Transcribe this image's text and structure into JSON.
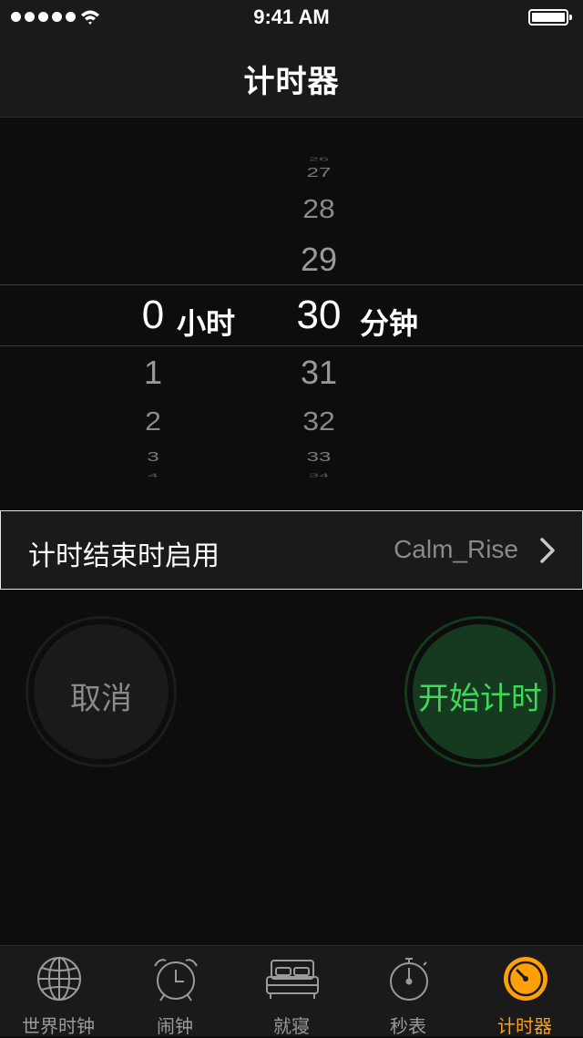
{
  "status_bar": {
    "time": "9:41 AM"
  },
  "nav": {
    "title": "计时器"
  },
  "picker": {
    "hours_above": [],
    "hours_selected": "0",
    "hours_unit": "小时",
    "hours_below": [
      "1",
      "2",
      "3",
      "4"
    ],
    "minutes_above": [
      "26",
      "27",
      "28",
      "29"
    ],
    "minutes_selected": "30",
    "minutes_unit": "分钟",
    "minutes_below": [
      "31",
      "32",
      "33",
      "34"
    ]
  },
  "sound_row": {
    "label": "计时结束时启用",
    "value": "Calm_Rise"
  },
  "buttons": {
    "cancel": "取消",
    "start": "开始计时"
  },
  "tabs": [
    {
      "label": "世界时钟",
      "icon": "globe-icon"
    },
    {
      "label": "闹钟",
      "icon": "alarm-clock-icon"
    },
    {
      "label": "就寝",
      "icon": "bed-icon"
    },
    {
      "label": "秒表",
      "icon": "stopwatch-icon"
    },
    {
      "label": "计时器",
      "icon": "timer-icon",
      "active": true
    }
  ],
  "colors": {
    "accent": "#ff9f0a",
    "start_green": "#3ed85b"
  }
}
